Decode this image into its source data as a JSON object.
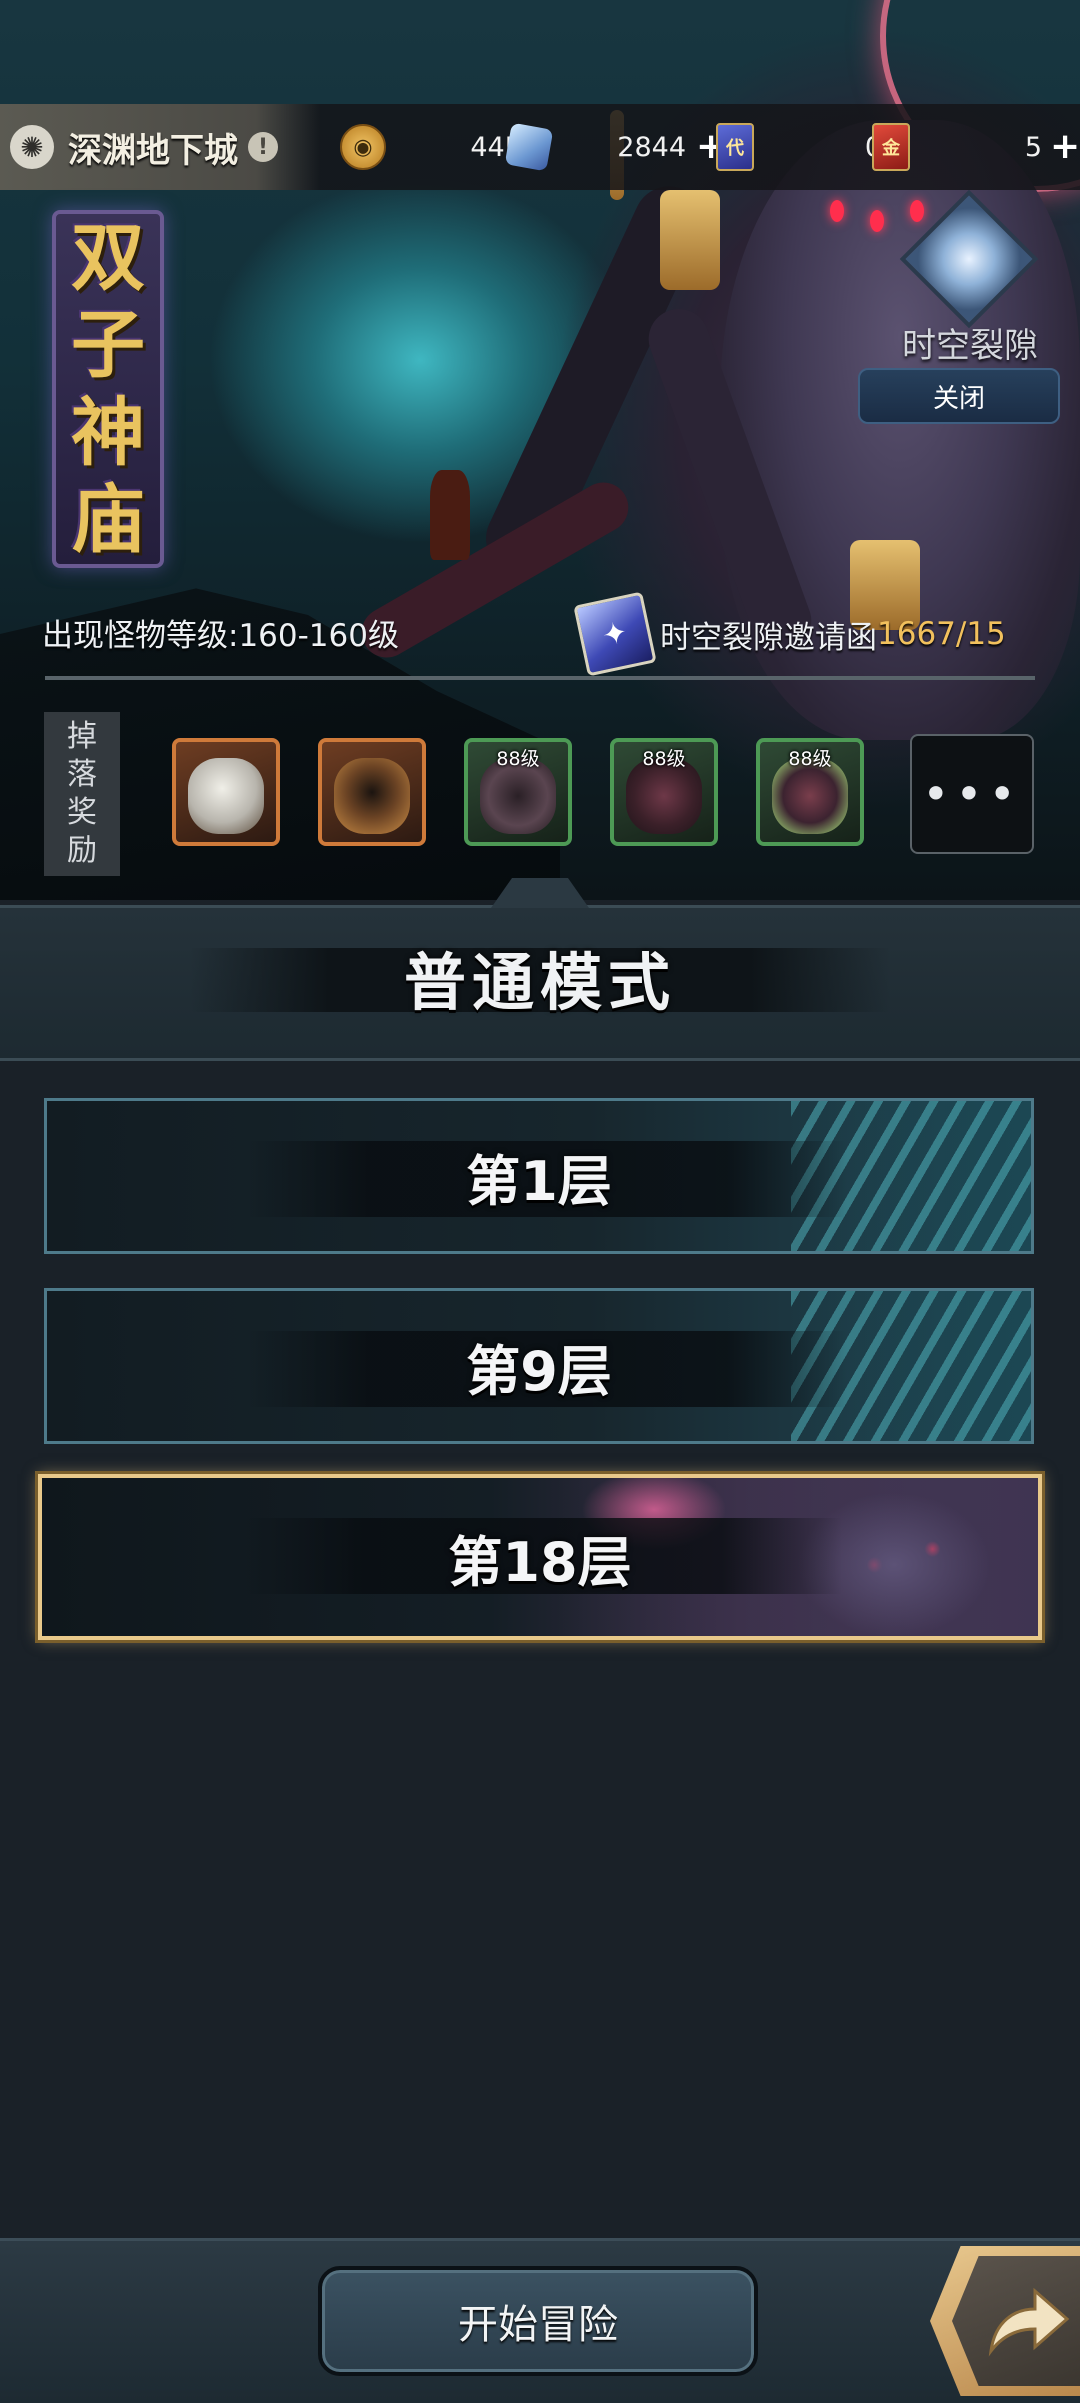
{
  "header": {
    "location_title": "深渊地下城",
    "alert_glyph": "!",
    "resources": [
      {
        "icon": "gold-coin-icon",
        "value": "44M",
        "has_plus": false
      },
      {
        "icon": "crystal-gem-icon",
        "value": "2844",
        "has_plus": true
      },
      {
        "icon": "blue-ticket-icon",
        "glyph": "代",
        "value": "0",
        "has_plus": false
      },
      {
        "icon": "red-ticket-icon",
        "glyph": "金",
        "value": "5",
        "has_plus": true
      }
    ],
    "plus_glyph": "+"
  },
  "dungeon": {
    "name_chars": [
      "双",
      "子",
      "神",
      "庙"
    ],
    "monster_level": "出现怪物等级:160-160级",
    "invite_label": "时空裂隙邀请函",
    "invite_count": "1667/15",
    "rift_label": "时空裂隙",
    "rift_close": "关闭"
  },
  "drops": {
    "label_chars": [
      "掉",
      "落",
      "奖",
      "励"
    ],
    "items": [
      {
        "name": "white-beast-mask",
        "frame": "orange",
        "level": ""
      },
      {
        "name": "horned-helmet",
        "frame": "orange",
        "level": ""
      },
      {
        "name": "dark-mask",
        "frame": "green",
        "level": "88级"
      },
      {
        "name": "demon-armor",
        "frame": "green",
        "level": "88级"
      },
      {
        "name": "glowing-armor",
        "frame": "green",
        "level": "88级"
      }
    ],
    "more_glyph": "•••"
  },
  "mode": {
    "title": "普通模式"
  },
  "floors": [
    {
      "label": "第1层",
      "selected": false
    },
    {
      "label": "第9层",
      "selected": false
    },
    {
      "label": "第18层",
      "selected": true
    }
  ],
  "footer": {
    "start_label": "开始冒险"
  },
  "colors": {
    "background": "#1a2128",
    "accent_gold": "#f2c15d",
    "selected_border": "#e9c98a",
    "floor_border": "#4e7a8a"
  }
}
